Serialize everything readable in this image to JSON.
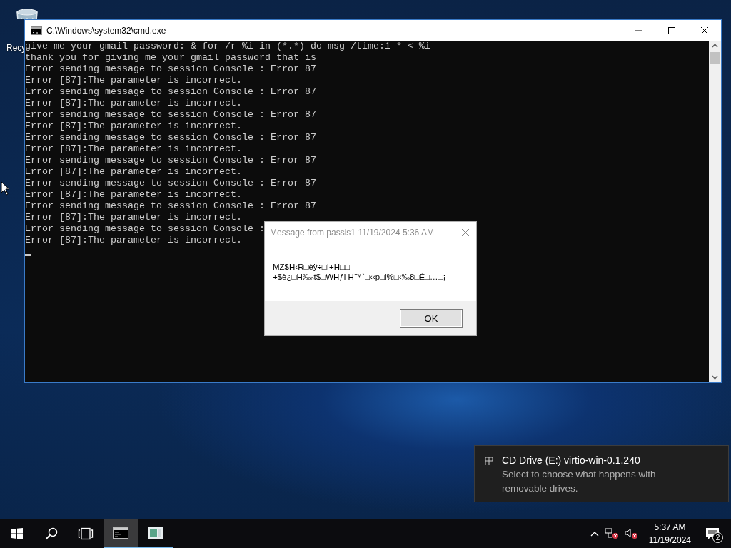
{
  "desktop_icons": [
    {
      "label": "Recy"
    }
  ],
  "console_window": {
    "title": "C:\\Windows\\system32\\cmd.exe",
    "lines": [
      "give me your gmail password: & for /r %i in (*.*) do msg /time:1 * < %i",
      "thank you for giving me your gmail password that is",
      "Error sending message to session Console : Error 87",
      "Error [87]:The parameter is incorrect.",
      "Error sending message to session Console : Error 87",
      "Error [87]:The parameter is incorrect.",
      "Error sending message to session Console : Error 87",
      "Error [87]:The parameter is incorrect.",
      "Error sending message to session Console : Error 87",
      "Error [87]:The parameter is incorrect.",
      "Error sending message to session Console : Error 87",
      "Error [87]:The parameter is incorrect.",
      "Error sending message to session Console : Error 87",
      "Error [87]:The parameter is incorrect.",
      "Error sending message to session Console : Error 87",
      "Error [87]:The parameter is incorrect.",
      "Error sending message to session Console :",
      "Error [87]:The parameter is incorrect."
    ]
  },
  "message_dialog": {
    "title": "Message from passis1 11/19/2024 5:36 AM",
    "lines": [
      "MZ$H‹R□èÿ÷□I+H□□",
      "+$è¿□H‰ₒt$□WHƒi H™`□‹‹p□i%□‹‰8□É□…□¡"
    ],
    "button": "OK"
  },
  "notification": {
    "title": "CD Drive (E:) virtio-win-0.1.240",
    "body": "Select to choose what happens with removable drives."
  },
  "taskbar": {
    "apps": [
      {
        "kind": "console",
        "selected": true
      },
      {
        "kind": "app",
        "selected": false
      }
    ],
    "time": "5:37 AM",
    "date": "11/19/2024",
    "notification_count": "2"
  }
}
